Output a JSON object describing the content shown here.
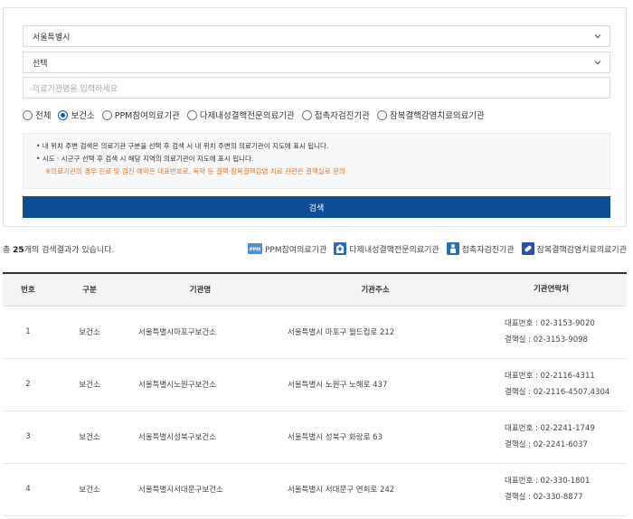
{
  "search": {
    "region_value": "서울특별시",
    "district_value": "선택",
    "name_placeholder": "의료기관명을 입력하세요",
    "radios": [
      {
        "label": "전체",
        "checked": false
      },
      {
        "label": "보건소",
        "checked": true
      },
      {
        "label": "PPM참여의료기관",
        "checked": false
      },
      {
        "label": "다제내성결핵전문의료기관",
        "checked": false
      },
      {
        "label": "접촉자검진기관",
        "checked": false
      },
      {
        "label": "잠복결핵감염치료의료기관",
        "checked": false
      }
    ],
    "notice": [
      "• 내 위치 주변 검색은 의료기관 구분을 선택 후 검색 시 내 위치 주변의 의료기관이 지도에 표시 됩니다.",
      "• 시도 · 시군구 선택 후 검색 시 해당 지역의 의료기관이 지도에 표시 됩니다.",
      "※의료기관의 경우 진료 및 검진 예약은 대표번호로, 독약 등 결핵·잠복결핵감염 치료 관련은 결핵실로 문의"
    ],
    "button_label": "검색"
  },
  "result": {
    "prefix": "총 ",
    "count": "25",
    "suffix": "개의 검색결과가 있습니다.",
    "legend": [
      {
        "label": "PPM참여의료기관",
        "icon": "ppm-icon",
        "color": "#4a90d9"
      },
      {
        "label": "다제내성결핵전문의료기관",
        "icon": "hospital-icon",
        "color": "#2a6db5"
      },
      {
        "label": "접촉자검진기관",
        "icon": "person-icon",
        "color": "#2a6db5"
      },
      {
        "label": "잠복결핵감염치료의료기관",
        "icon": "capsule-icon",
        "color": "#2a4fa8"
      }
    ]
  },
  "table": {
    "headers": [
      "번호",
      "구분",
      "기관명",
      "기관주소",
      "기관연락처"
    ],
    "rows": [
      {
        "no": "1",
        "type": "보건소",
        "name": "서울특별시마포구보건소",
        "addr": "서울특별시 마포구 월드컵로 212",
        "rep": "대표번호 : 02-3153-9020",
        "tb": "결핵실 : 02-3153-9098"
      },
      {
        "no": "2",
        "type": "보건소",
        "name": "서울특별시노원구보건소",
        "addr": "서울특별시 노원구 노해로 437",
        "rep": "대표번호 : 02-2116-4311",
        "tb": "결핵실 : 02-2116-4507,4304"
      },
      {
        "no": "3",
        "type": "보건소",
        "name": "서울특별시성북구보건소",
        "addr": "서울특별시 성북구 화랑로 63",
        "rep": "대표번호 : 02-2241-1749",
        "tb": "결핵실 : 02-2241-6037"
      },
      {
        "no": "4",
        "type": "보건소",
        "name": "서울특별시서대문구보건소",
        "addr": "서울특별시 서대문구 연희로 242",
        "rep": "대표번호 : 02-330-1801",
        "tb": "결핵실 : 02-330-8877"
      }
    ]
  },
  "colors": {
    "primary": "#0f4e96",
    "warn": "#e07a2a"
  }
}
